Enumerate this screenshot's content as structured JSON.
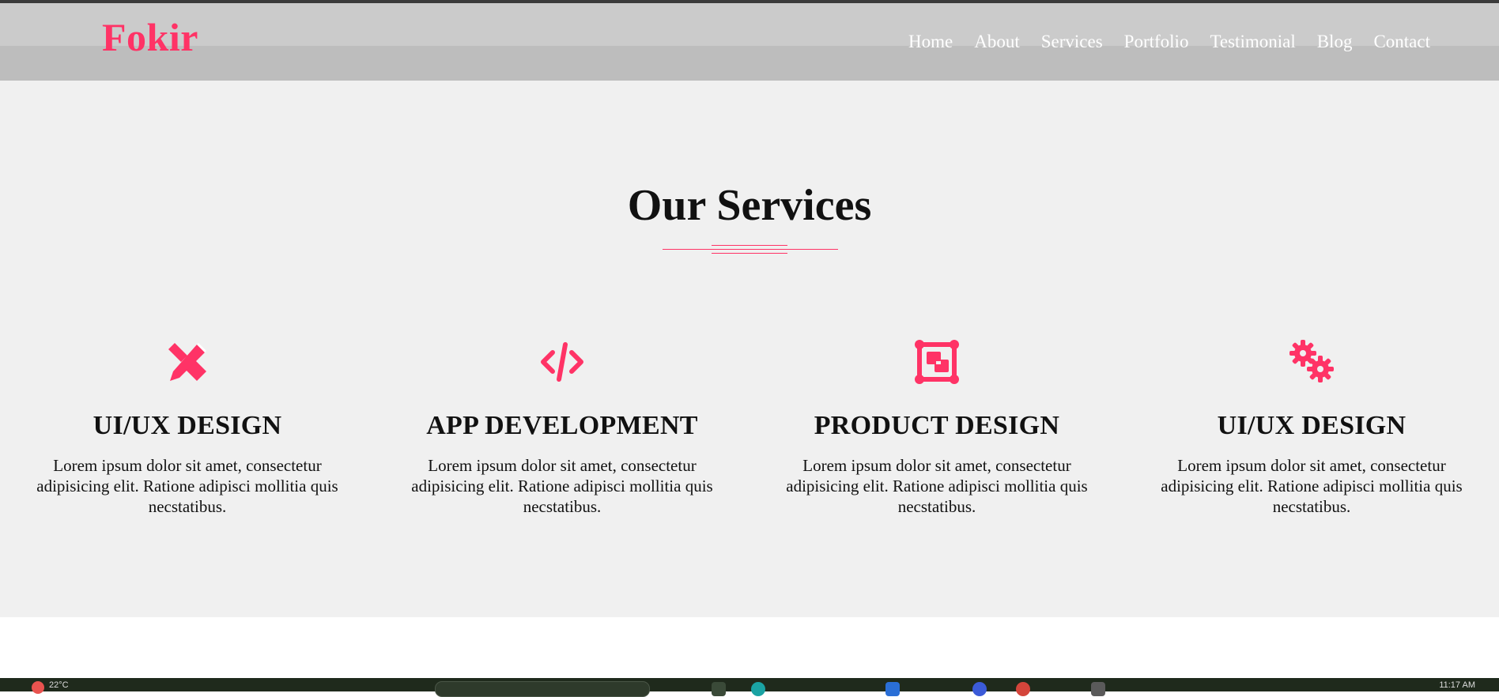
{
  "brand": {
    "logo_text": "Fokir",
    "accent_color": "#ff3366"
  },
  "nav": {
    "items": [
      "Home",
      "About",
      "Services",
      "Portfolio",
      "Testimonial",
      "Blog",
      "Contact"
    ]
  },
  "services": {
    "title": "Our Services",
    "cards": [
      {
        "icon": "pencil-ruler-icon",
        "title": "UI/UX DESIGN",
        "text": "Lorem ipsum dolor sit amet, consectetur adipisicing elit. Ratione adipisci mollitia quis necstatibus."
      },
      {
        "icon": "code-icon",
        "title": "APP DEVELOPMENT",
        "text": "Lorem ipsum dolor sit amet, consectetur adipisicing elit. Ratione adipisci mollitia quis necstatibus."
      },
      {
        "icon": "vector-square-icon",
        "title": "PRODUCT DESIGN",
        "text": "Lorem ipsum dolor sit amet, consectetur adipisicing elit. Ratione adipisci mollitia quis necstatibus."
      },
      {
        "icon": "cogs-icon",
        "title": "UI/UX DESIGN",
        "text": "Lorem ipsum dolor sit amet, consectetur adipisicing elit. Ratione adipisci mollitia quis necstatibus."
      }
    ]
  },
  "taskbar": {
    "temperature": "22°C",
    "clock": "11:17 AM"
  }
}
